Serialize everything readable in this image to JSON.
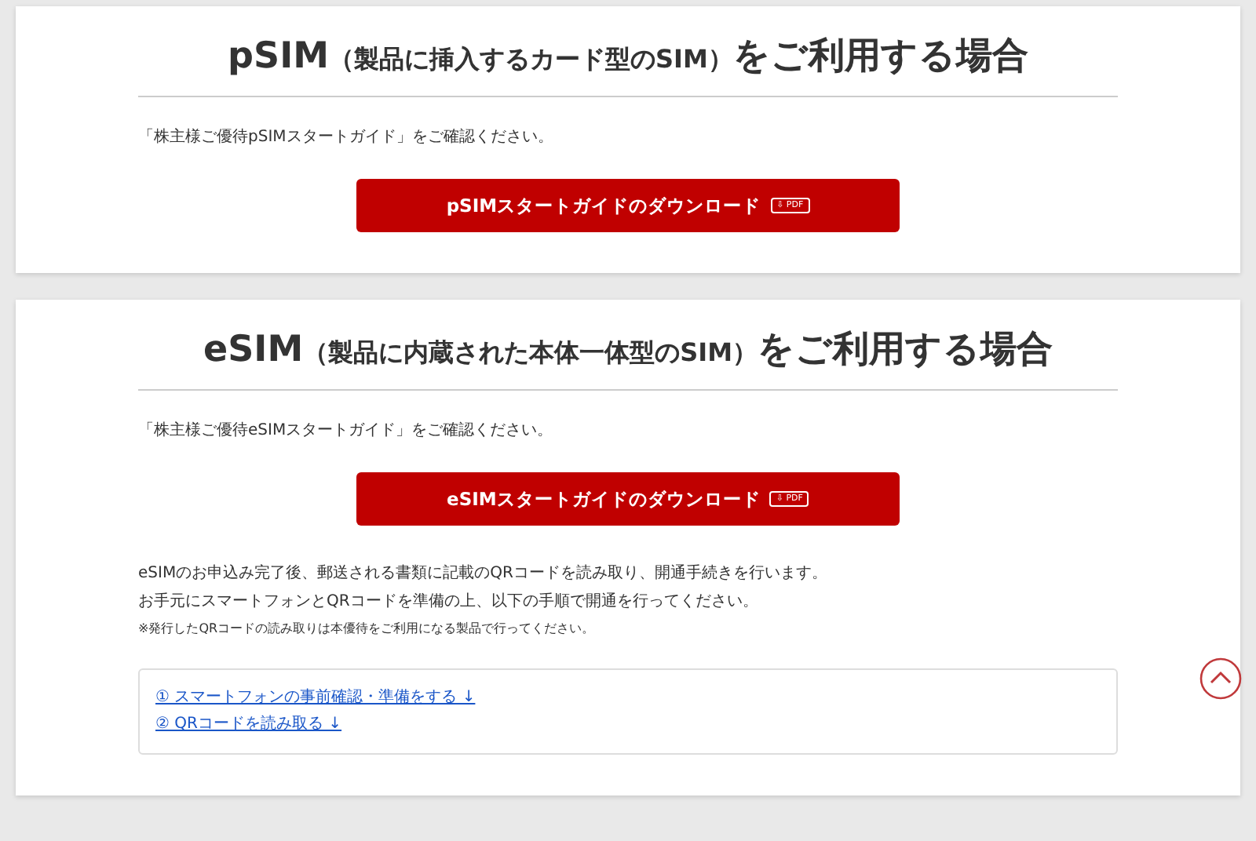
{
  "sections": [
    {
      "heading": {
        "main": "pSIM",
        "sub": "（製品に挿入するカード型のSIM）",
        "tail": "をご利用する場合"
      },
      "intro": "「株主様ご優待pSIMスタートガイド」をご確認ください。",
      "button": {
        "label": "pSIMスタートガイドのダウンロード",
        "badge": "⇩ PDF"
      }
    },
    {
      "heading": {
        "main": "eSIM",
        "sub": "（製品に内蔵された本体一体型のSIM）",
        "tail": "をご利用する場合"
      },
      "intro": "「株主様ご優待eSIMスタートガイド」をご確認ください。",
      "button": {
        "label": "eSIMスタートガイドのダウンロード",
        "badge": "⇩ PDF"
      },
      "paragraphs": [
        "eSIMのお申込み完了後、郵送される書類に記載のQRコードを読み取り、開通手続きを行います。",
        "お手元にスマートフォンとQRコードを準備の上、以下の手順で開通を行ってください。"
      ],
      "note": "※発行したQRコードの読み取りは本優待をご利用になる製品で行ってください。",
      "links": [
        {
          "label": "① スマートフォンの事前確認・準備をする",
          "arrow": "↓"
        },
        {
          "label": "② QRコードを読み取る",
          "arrow": "↓"
        }
      ]
    }
  ]
}
